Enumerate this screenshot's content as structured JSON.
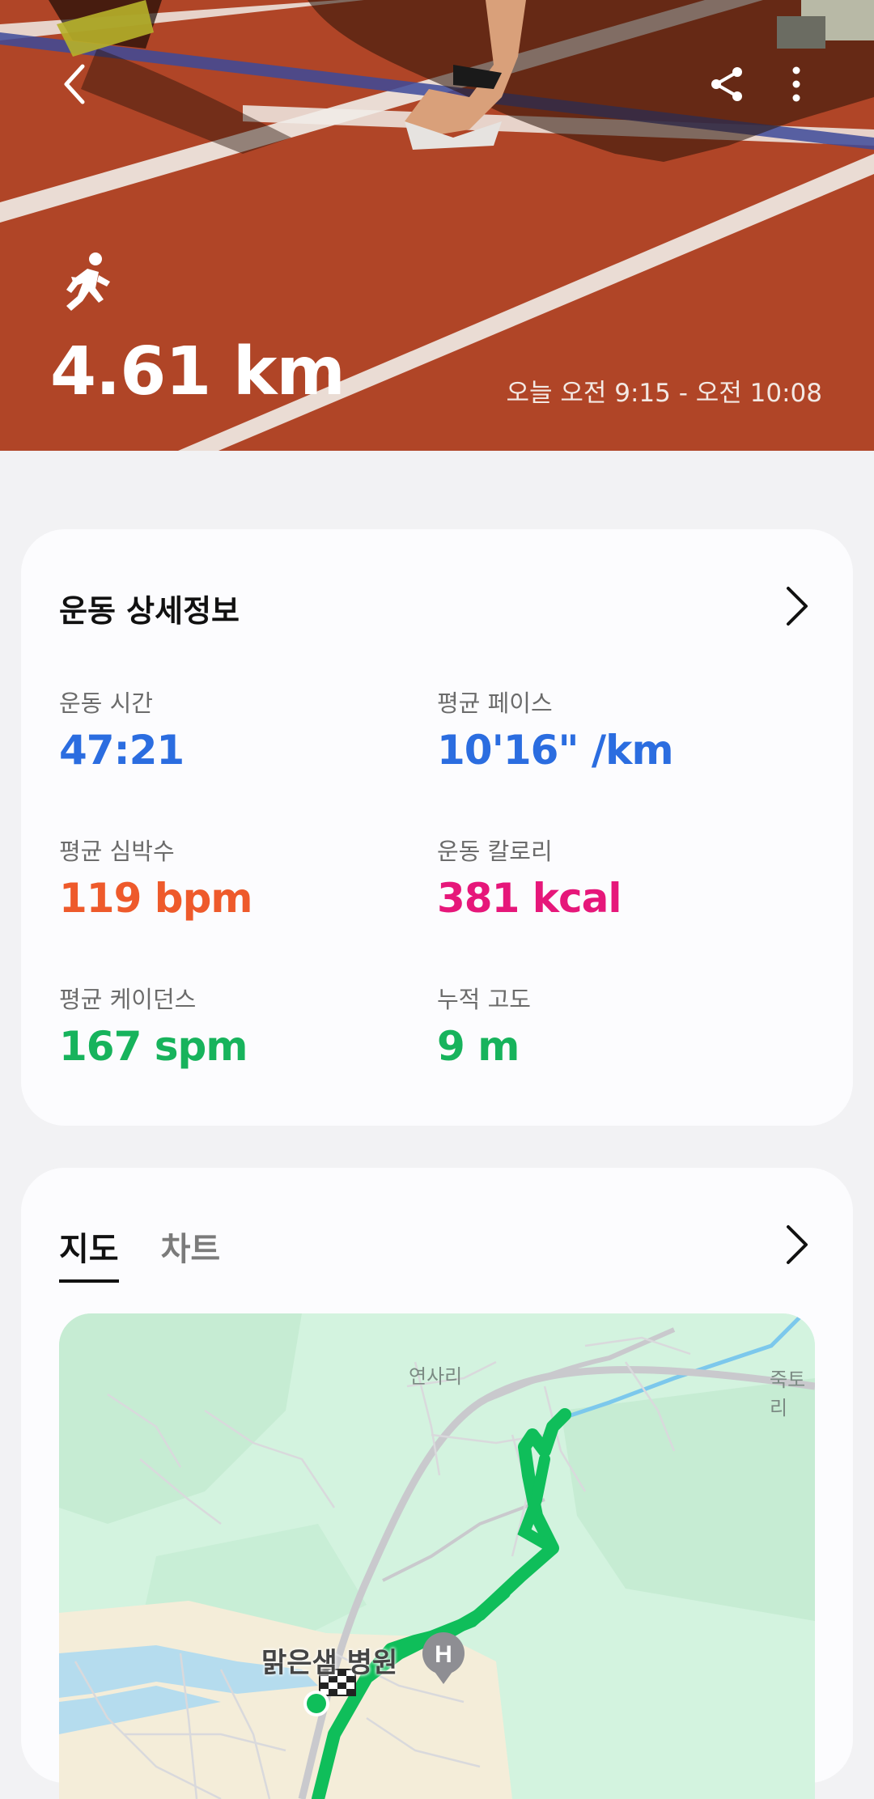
{
  "header": {
    "distance": "4.61 km",
    "time_range": "오늘 오전 9:15 - 오전 10:08",
    "icons": [
      "back-icon",
      "share-icon",
      "more-vertical-icon",
      "running-icon"
    ]
  },
  "details": {
    "title": "운동 상세정보",
    "metrics": [
      {
        "label": "운동 시간",
        "value": "47:21",
        "color": "#2b6de0"
      },
      {
        "label": "평균 페이스",
        "value": "10'16\" /km",
        "color": "#2b6de0"
      },
      {
        "label": "평균 심박수",
        "value": "119 bpm",
        "color": "#ee5a2b"
      },
      {
        "label": "운동 칼로리",
        "value": "381 kcal",
        "color": "#e6177a"
      },
      {
        "label": "평균 케이던스",
        "value": "167 spm",
        "color": "#17b35c"
      },
      {
        "label": "누적 고도",
        "value": "9 m",
        "color": "#17b35c"
      }
    ]
  },
  "map_section": {
    "tabs": [
      {
        "label": "지도",
        "active": true
      },
      {
        "label": "차트",
        "active": false
      }
    ],
    "place_labels": [
      "연사리",
      "죽토리",
      "맑은샘 병원"
    ],
    "route_color": "#0fbe5a"
  }
}
